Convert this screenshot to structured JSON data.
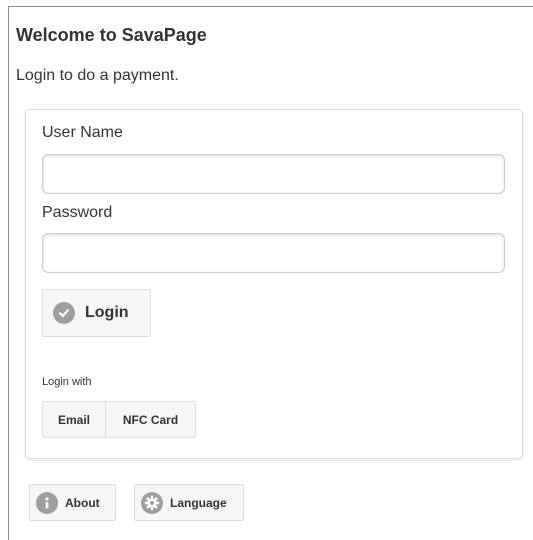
{
  "header": {
    "title": "Welcome to SavaPage",
    "subtitle": "Login to do a payment."
  },
  "form": {
    "username_label": "User Name",
    "username_value": "",
    "password_label": "Password",
    "password_value": "",
    "login_label": "Login",
    "login_with_label": "Login with",
    "methods": [
      "Email",
      "NFC Card"
    ]
  },
  "footer": {
    "about_label": "About",
    "language_label": "Language"
  },
  "icons": {
    "login": "check-circle-icon",
    "about": "info-circle-icon",
    "language": "gear-circle-icon"
  },
  "colors": {
    "button_bg": "#f6f6f6",
    "icon_bg": "#9e9e9e",
    "text": "#333333"
  }
}
